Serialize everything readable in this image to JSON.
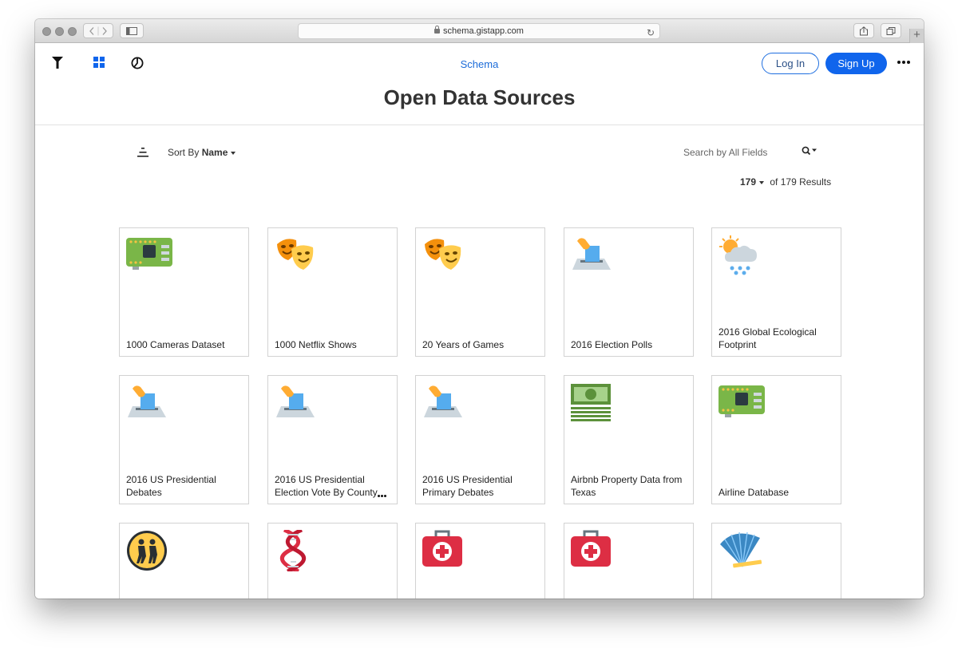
{
  "browser": {
    "url": "schema.gistapp.com"
  },
  "nav": {
    "brand": "Schema",
    "login": "Log In",
    "signup": "Sign Up"
  },
  "page": {
    "title": "Open Data Sources"
  },
  "toolbar": {
    "sort_prefix": "Sort By",
    "sort_value": "Name",
    "search_placeholder": "Search by All Fields",
    "results_count": "179",
    "results_suffix": "of 179 Results"
  },
  "cards": [
    {
      "label": "1000 Cameras Dataset",
      "icon": "circuit-board-icon"
    },
    {
      "label": "1000 Netflix Shows",
      "icon": "theater-masks-icon"
    },
    {
      "label": "20 Years of Games",
      "icon": "theater-masks-icon"
    },
    {
      "label": "2016 Election Polls",
      "icon": "ballot-box-icon"
    },
    {
      "label": "2016 Global Ecological Footprint",
      "icon": "sun-rain-cloud-icon"
    },
    {
      "label": "2016 US Presidential Debates",
      "icon": "ballot-box-icon"
    },
    {
      "label": "2016 US Presidential Election Vote By County",
      "icon": "ballot-box-icon"
    },
    {
      "label": "2016 US Presidential Primary Debates",
      "icon": "ballot-box-icon"
    },
    {
      "label": "Airbnb Property Data from Texas",
      "icon": "money-stack-icon"
    },
    {
      "label": "Airline Database",
      "icon": "circuit-board-icon"
    },
    {
      "label": "",
      "icon": "children-crossing-icon"
    },
    {
      "label": "",
      "icon": "dna-icon"
    },
    {
      "label": "",
      "icon": "first-aid-kit-icon"
    },
    {
      "label": "",
      "icon": "first-aid-kit-icon"
    },
    {
      "label": "",
      "icon": "folding-fan-icon"
    }
  ],
  "colors": {
    "accent": "#1065ec",
    "brand_link": "#1b6bd8",
    "title": "#333333"
  }
}
